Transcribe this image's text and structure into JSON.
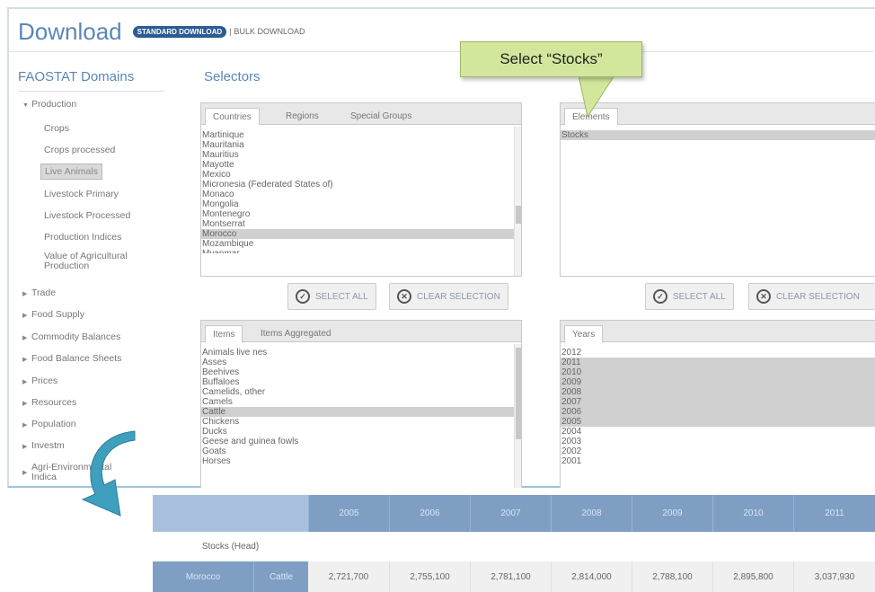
{
  "header": {
    "title": "Download",
    "standard_label": "STANDARD DOWNLOAD",
    "separator": "|",
    "bulk_label": "BULK DOWNLOAD"
  },
  "domains": {
    "title": "FAOSTAT Domains",
    "groups": [
      {
        "label": "Production",
        "expanded": true
      },
      {
        "label": "Trade"
      },
      {
        "label": "Food Supply"
      },
      {
        "label": "Commodity Balances"
      },
      {
        "label": "Food Balance Sheets"
      },
      {
        "label": "Prices"
      },
      {
        "label": "Resources"
      },
      {
        "label": "Population"
      },
      {
        "label": "Investm"
      },
      {
        "label": "Agri-Environmental",
        "label2": "Indica"
      }
    ],
    "production_items": [
      "Crops",
      "Crops processed",
      "Live Animals",
      "Livestock Primary",
      "Livestock Processed",
      "Production Indices",
      "Value of Agricultural",
      "Production"
    ],
    "selected_item": "Live Animals"
  },
  "selectors": {
    "title": "Selectors",
    "countries_tabs": [
      "Countries",
      "Regions",
      "Special Groups"
    ],
    "countries": [
      "Martinique",
      "Mauritania",
      "Mauritius",
      "Mayotte",
      "Mexico",
      "Micronesia (Federated States of)",
      "Monaco",
      "Mongolia",
      "Montenegro",
      "Montserrat",
      "Morocco",
      "Mozambique",
      "Myanmar"
    ],
    "countries_selected": "Morocco",
    "elements_tabs": [
      "Elements"
    ],
    "elements": [
      "Stocks"
    ],
    "items_tabs": [
      "Items",
      "Items Aggregated"
    ],
    "items": [
      "Animals live nes",
      "Asses",
      "Beehives",
      "Buffaloes",
      "Camelids, other",
      "Camels",
      "Cattle",
      "Chickens",
      "Ducks",
      "Geese and guinea fowls",
      "Goats",
      "Horses"
    ],
    "items_selected": "Cattle",
    "years_tabs": [
      "Years"
    ],
    "years": [
      "2012",
      "2011",
      "2010",
      "2009",
      "2008",
      "2007",
      "2006",
      "2005",
      "2004",
      "2003",
      "2002",
      "2001"
    ],
    "years_selected": [
      "2011",
      "2010",
      "2009",
      "2008",
      "2007",
      "2006",
      "2005"
    ],
    "select_all": "SELECT ALL",
    "clear_selection": "CLEAR SELECTION"
  },
  "callout": {
    "text": "Select  “Stocks”"
  },
  "table": {
    "years": [
      "2005",
      "2006",
      "2007",
      "2008",
      "2009",
      "2010",
      "2011"
    ],
    "stocks_label": "Stocks (Head)",
    "country": "Morocco",
    "item": "Cattle",
    "values": [
      "2,721,700",
      "2,755,100",
      "2,781,100",
      "2,814,000",
      "2,788,100",
      "2,895,800",
      "3,037,930"
    ]
  },
  "colors": {
    "accent": "#5a87b8",
    "table_header": "#7f9ec4",
    "callout": "#d2e79c",
    "arrow": "#3e9fbe"
  }
}
